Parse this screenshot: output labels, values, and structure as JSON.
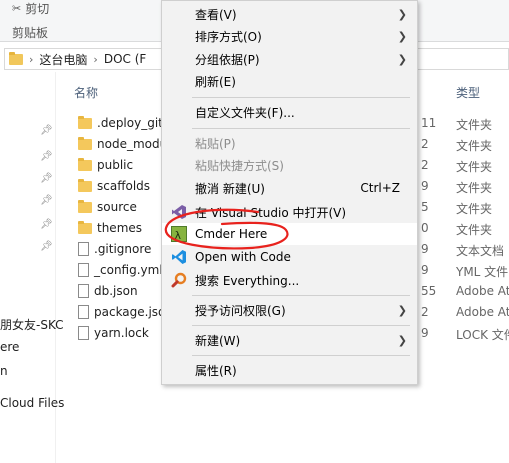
{
  "ribbon": {
    "cut_label": "剪切",
    "clipboard_label": "剪贴板"
  },
  "address": {
    "path": [
      "这台电脑",
      "DOC (F"
    ]
  },
  "columns": {
    "name": "名称",
    "type": "类型"
  },
  "nav": {
    "items": [
      {
        "label": "朋女友-SKC"
      },
      {
        "label": "ere"
      },
      {
        "label": "n"
      },
      {
        "label": "Cloud Files"
      }
    ]
  },
  "files": [
    {
      "name": ".deploy_git",
      "kind": "folder",
      "date_frag": "11",
      "type": "文件夹"
    },
    {
      "name": "node_modu",
      "kind": "folder",
      "date_frag": "2",
      "type": "文件夹"
    },
    {
      "name": "public",
      "kind": "folder",
      "date_frag": "2",
      "type": "文件夹"
    },
    {
      "name": "scaffolds",
      "kind": "folder",
      "date_frag": "9",
      "type": "文件夹"
    },
    {
      "name": "source",
      "kind": "folder",
      "date_frag": "5",
      "type": "文件夹"
    },
    {
      "name": "themes",
      "kind": "folder",
      "date_frag": "0",
      "type": "文件夹"
    },
    {
      "name": ".gitignore",
      "kind": "file",
      "date_frag": "9",
      "type": "文本文档"
    },
    {
      "name": "_config.yml",
      "kind": "file",
      "date_frag": "9",
      "type": "YML 文件"
    },
    {
      "name": "db.json",
      "kind": "file",
      "date_frag": "55",
      "type": "Adobe At"
    },
    {
      "name": "package.jso",
      "kind": "file",
      "date_frag": "2",
      "type": "Adobe At"
    },
    {
      "name": "yarn.lock",
      "kind": "file",
      "date_frag": "9",
      "type": "LOCK 文件"
    }
  ],
  "menu": {
    "items": [
      {
        "label": "查看(V)",
        "submenu": true
      },
      {
        "label": "排序方式(O)",
        "submenu": true
      },
      {
        "label": "分组依据(P)",
        "submenu": true
      },
      {
        "label": "刷新(E)"
      },
      {
        "label": "自定义文件夹(F)..."
      },
      {
        "label": "粘贴(P)",
        "disabled": true
      },
      {
        "label": "粘贴快捷方式(S)",
        "disabled": true
      },
      {
        "label": "撤消 新建(U)",
        "shortcut": "Ctrl+Z"
      },
      {
        "label": "在 Visual Studio 中打开(V)",
        "icon": "visual-studio-icon"
      },
      {
        "label": "Cmder Here",
        "icon": "cmder-icon"
      },
      {
        "label": "Open with Code",
        "icon": "vscode-icon"
      },
      {
        "label": "搜索 Everything...",
        "icon": "everything-search-icon"
      },
      {
        "label": "授予访问权限(G)",
        "submenu": true
      },
      {
        "label": "新建(W)",
        "submenu": true
      },
      {
        "label": "属性(R)"
      }
    ]
  },
  "colors": {
    "highlight_circle": "#e8221d",
    "menu_bg": "#f2f2f2",
    "folder": "#f4c85c"
  }
}
